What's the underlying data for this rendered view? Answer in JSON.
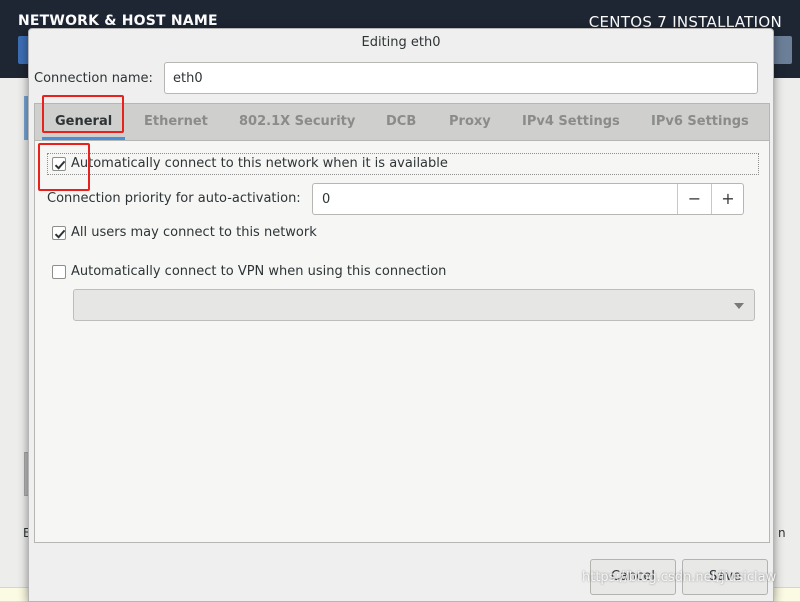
{
  "background": {
    "title": "NETWORK & HOST NAME",
    "product": "CENTOS 7 INSTALLATION",
    "left_letter": "E",
    "right_letter": "n"
  },
  "dialog": {
    "title": "Editing eth0",
    "connection_name_label": "Connection name:",
    "connection_name_value": "eth0",
    "tabs": [
      {
        "label": "General",
        "active": true
      },
      {
        "label": "Ethernet",
        "active": false
      },
      {
        "label": "802.1X Security",
        "active": false
      },
      {
        "label": "DCB",
        "active": false
      },
      {
        "label": "Proxy",
        "active": false
      },
      {
        "label": "IPv4 Settings",
        "active": false
      },
      {
        "label": "IPv6 Settings",
        "active": false
      }
    ],
    "general": {
      "auto_connect": {
        "label": "Automatically connect to this network when it is available",
        "checked": true
      },
      "priority": {
        "label": "Connection priority for auto-activation:",
        "value": "0",
        "minus": "−",
        "plus": "+"
      },
      "all_users": {
        "label": "All users may connect to this network",
        "checked": true
      },
      "auto_vpn": {
        "label": "Automatically connect to VPN when using this connection",
        "checked": false
      },
      "vpn_select": {
        "value": ""
      }
    },
    "buttons": {
      "cancel": "Cancel",
      "save": "Save"
    }
  },
  "watermark": "https://blog.csdn.net/jiusiclaw",
  "colors": {
    "accent": "#4a90d9",
    "highlight": "#e8211d",
    "header": "#1e2634"
  }
}
